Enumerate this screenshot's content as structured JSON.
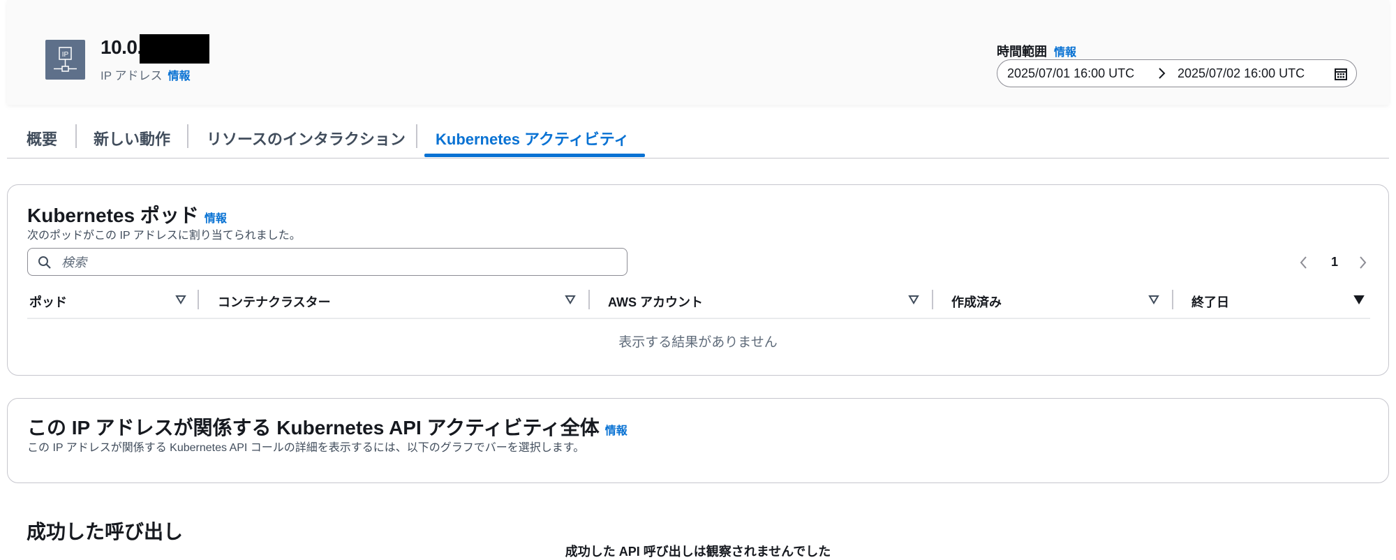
{
  "header": {
    "ip_title": "10.0.",
    "ip_subtitle": "IP アドレス",
    "info_label": "情報",
    "icon": "ip-address-icon",
    "time_range_label": "時間範囲",
    "time_start": "2025/07/01 16:00 UTC",
    "time_end": "2025/07/02 16:00 UTC"
  },
  "tabs": [
    {
      "label": "概要"
    },
    {
      "label": "新しい動作"
    },
    {
      "label": "リソースのインタラクション"
    },
    {
      "label": "Kubernetes アクティビティ",
      "active": true
    }
  ],
  "pods": {
    "title": "Kubernetes ポッド",
    "info": "情報",
    "description": "次のポッドがこの IP アドレスに割り当てられました。",
    "search_placeholder": "検索",
    "page": "1",
    "columns": [
      "ポッド",
      "コンテナクラスター",
      "AWS アカウント",
      "作成済み",
      "終了日"
    ],
    "empty_message": "表示する結果がありません"
  },
  "api_activity": {
    "title": "この IP アドレスが関係する Kubernetes API アクティビティ全体",
    "info": "情報",
    "description": "この IP アドレスが関係する Kubernetes API コールの詳細を表示するには、以下のグラフでバーを選択します。"
  },
  "successful_calls": {
    "title": "成功した呼び出し",
    "message": "成功した API 呼び出しは観察されませんでした"
  },
  "colors": {
    "accent": "#0972d3",
    "icon_bg": "#5e708a"
  }
}
